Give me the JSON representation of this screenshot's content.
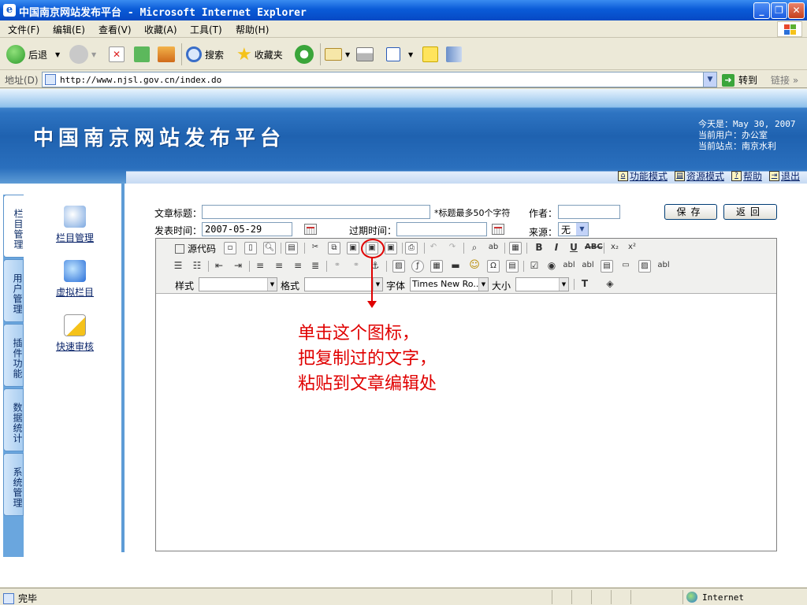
{
  "window": {
    "title": "中国南京网站发布平台 - Microsoft Internet Explorer",
    "icon": "ie-icon",
    "controls": {
      "minimize": "_",
      "maximize": "❐",
      "close": "✕"
    }
  },
  "menubar": {
    "items": [
      "文件(F)",
      "编辑(E)",
      "查看(V)",
      "收藏(A)",
      "工具(T)",
      "帮助(H)"
    ]
  },
  "toolbar": {
    "back_label": "后退",
    "search_label": "搜索",
    "favorites_label": "收藏夹"
  },
  "address": {
    "label": "地址(D)",
    "url": "http://www.njsl.gov.cn/index.do",
    "go_label": "转到",
    "links_label": "链接"
  },
  "banner": {
    "site_name": "中国南京网站发布平台",
    "date_line": "今天是：May 30, 2007",
    "user_line": "当前用户：办公室",
    "site_line": "当前站点：南京水利"
  },
  "nav_links": [
    "功能模式",
    "资源模式",
    "帮助",
    "退出"
  ],
  "sidebar": {
    "tabs": [
      "栏目管理",
      "用户管理",
      "插件功能",
      "数据统计",
      "系统管理"
    ],
    "items": [
      "栏目管理",
      "虚拟栏目",
      "快速审核"
    ]
  },
  "form": {
    "title_label": "文章标题：",
    "title_value": "",
    "title_hint": "*标题最多50个字符",
    "author_label": "作者：",
    "author_value": "",
    "publish_label": "发表时间：",
    "publish_value": "2007-05-29",
    "expire_label": "过期时间：",
    "expire_value": "",
    "source_label": "来源：",
    "source_value": "无",
    "save_label": "保存",
    "back_label": "返回"
  },
  "editor": {
    "source_label": "源代码",
    "style_label": "样式",
    "format_label": "格式",
    "font_label": "字体",
    "font_value": "Times New Ro...",
    "size_label": "大小"
  },
  "annotation": {
    "lines": [
      "单击这个图标，",
      "把复制过的文字，",
      "粘贴到文章编辑处"
    ],
    "color": "#e00000"
  },
  "status": {
    "text": "完毕",
    "zone": "Internet"
  }
}
